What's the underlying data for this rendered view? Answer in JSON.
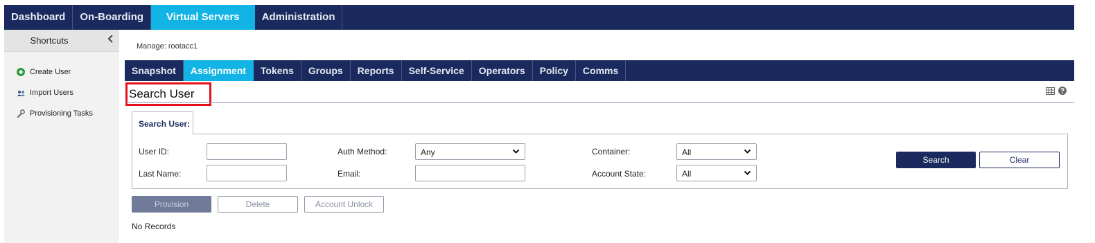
{
  "topnav": {
    "tabs": [
      "Dashboard",
      "On-Boarding",
      "Virtual Servers",
      "Administration"
    ],
    "active": "Virtual Servers"
  },
  "sidebar": {
    "title": "Shortcuts",
    "items": [
      {
        "label": "Create User",
        "icon": "plus-circle-icon"
      },
      {
        "label": "Import Users",
        "icon": "import-users-icon"
      },
      {
        "label": "Provisioning Tasks",
        "icon": "wrench-icon"
      }
    ]
  },
  "manage": "Manage: rootacc1",
  "subnav": {
    "tabs": [
      "Snapshot",
      "Assignment",
      "Tokens",
      "Groups",
      "Reports",
      "Self-Service",
      "Operators",
      "Policy",
      "Comms"
    ],
    "active": "Assignment"
  },
  "section_title": "Search User",
  "panel_tab": "Search User:",
  "form": {
    "user_id_label": "User ID:",
    "last_name_label": "Last Name:",
    "auth_method_label": "Auth Method:",
    "auth_method_value": "Any",
    "email_label": "Email:",
    "container_label": "Container:",
    "container_value": "All",
    "account_state_label": "Account State:",
    "account_state_value": "All",
    "search_label": "Search",
    "clear_label": "Clear"
  },
  "actions": {
    "provision": "Provision",
    "delete": "Delete",
    "unlock": "Account Unlock"
  },
  "status": "No Records",
  "colors": {
    "navy": "#1b2a5e",
    "accent": "#11b4e4",
    "highlight": "#e3101a"
  }
}
